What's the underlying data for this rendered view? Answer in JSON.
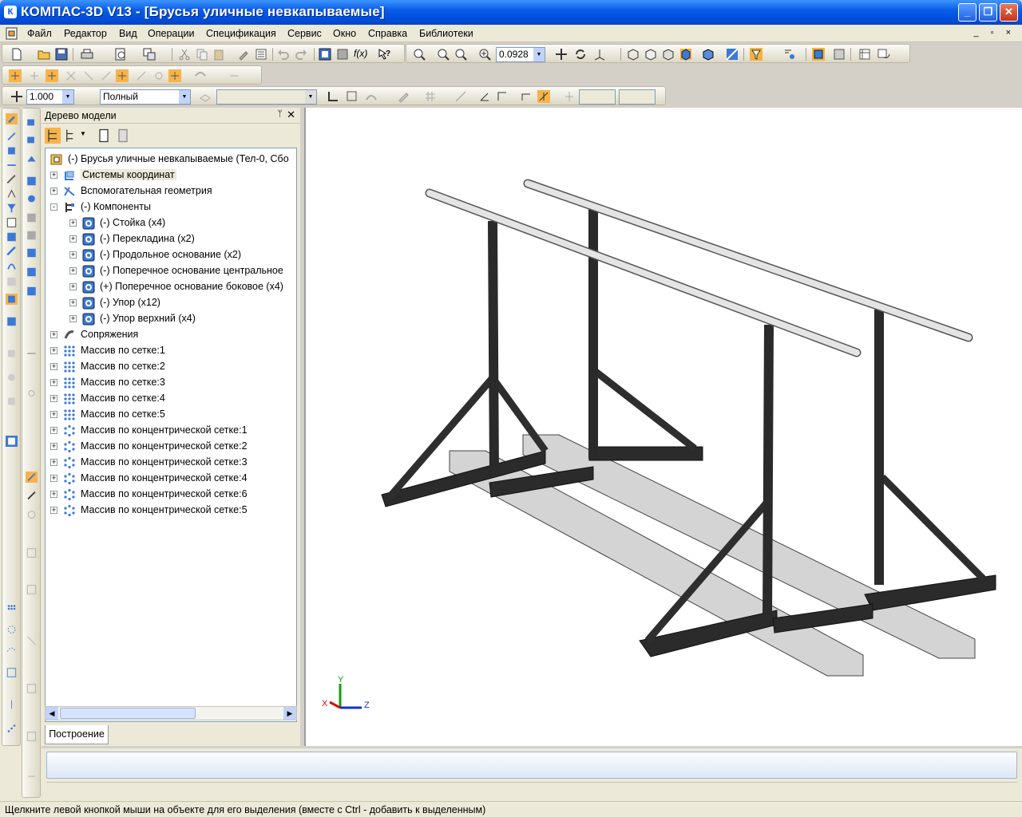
{
  "window": {
    "title": "КОМПАС-3D V13 - [Брусья уличные невкапываемые]",
    "app_icon": "kompas-logo-icon",
    "controls": [
      "_",
      "❐",
      "✕"
    ]
  },
  "menu": {
    "items": [
      "Файл",
      "Редактор",
      "Вид",
      "Операции",
      "Спецификация",
      "Сервис",
      "Окно",
      "Справка",
      "Библиотеки"
    ]
  },
  "toolbar": {
    "zoom_value": "0.0928",
    "step_value": "1.000",
    "mode_value": "Полный"
  },
  "tree_panel": {
    "title": "Дерево модели",
    "root": "(-) Брусья уличные невкапываемые (Тел-0, Сбо",
    "items": [
      {
        "label": "Системы координат",
        "level": 1,
        "icon": "coord-system-icon",
        "expand": "+"
      },
      {
        "label": "Вспомогательная геометрия",
        "level": 1,
        "icon": "aux-geometry-icon",
        "expand": "+"
      },
      {
        "label": "(-) Компоненты",
        "level": 1,
        "icon": "components-icon",
        "expand": "-"
      },
      {
        "label": "(-) Стойка (х4)",
        "level": 2,
        "icon": "part-icon",
        "expand": "+"
      },
      {
        "label": "(-) Перекладина (х2)",
        "level": 2,
        "icon": "part-icon",
        "expand": "+"
      },
      {
        "label": "(-) Продольное основание (х2)",
        "level": 2,
        "icon": "part-icon",
        "expand": "+"
      },
      {
        "label": "(-) Поперечное основание центральное",
        "level": 2,
        "icon": "part-icon",
        "expand": "+"
      },
      {
        "label": "(+) Поперечное основание боковое (х4)",
        "level": 2,
        "icon": "part-icon",
        "expand": "+"
      },
      {
        "label": "(-) Упор (х12)",
        "level": 2,
        "icon": "part-icon",
        "expand": "+"
      },
      {
        "label": "(-) Упор верхний (х4)",
        "level": 2,
        "icon": "part-icon",
        "expand": "+"
      },
      {
        "label": "Сопряжения",
        "level": 1,
        "icon": "mates-icon",
        "expand": "+"
      },
      {
        "label": "Массив по сетке:1",
        "level": 1,
        "icon": "grid-array-icon",
        "expand": "+"
      },
      {
        "label": "Массив по сетке:2",
        "level": 1,
        "icon": "grid-array-icon",
        "expand": "+"
      },
      {
        "label": "Массив по сетке:3",
        "level": 1,
        "icon": "grid-array-icon",
        "expand": "+"
      },
      {
        "label": "Массив по сетке:4",
        "level": 1,
        "icon": "grid-array-icon",
        "expand": "+"
      },
      {
        "label": "Массив по сетке:5",
        "level": 1,
        "icon": "grid-array-icon",
        "expand": "+"
      },
      {
        "label": "Массив по концентрической сетке:1",
        "level": 1,
        "icon": "circular-array-icon",
        "expand": "+"
      },
      {
        "label": "Массив по концентрической сетке:2",
        "level": 1,
        "icon": "circular-array-icon",
        "expand": "+"
      },
      {
        "label": "Массив по концентрической сетке:3",
        "level": 1,
        "icon": "circular-array-icon",
        "expand": "+"
      },
      {
        "label": "Массив по концентрической сетке:4",
        "level": 1,
        "icon": "circular-array-icon",
        "expand": "+"
      },
      {
        "label": "Массив по концентрической сетке:6",
        "level": 1,
        "icon": "circular-array-icon",
        "expand": "+"
      },
      {
        "label": "Массив по концентрической сетке:5",
        "level": 1,
        "icon": "circular-array-icon",
        "expand": "+"
      }
    ],
    "tab": "Построение"
  },
  "viewport": {
    "axes": {
      "x": "X",
      "y": "Y",
      "z": "Z"
    },
    "axis_colors": {
      "x": "#d01010",
      "y": "#10a010",
      "z": "#1030d0"
    }
  },
  "status": {
    "text": "Щелкните левой кнопкой мыши на объекте для его выделения (вместе с Ctrl - добавить к выделенным)"
  },
  "colors": {
    "titlebar": "#0a5ee6",
    "frame": "#ece9d8",
    "selected_tree": "#ece9d8",
    "steel_dark": "#2b2b2b",
    "steel_light": "#c8c8c8"
  }
}
